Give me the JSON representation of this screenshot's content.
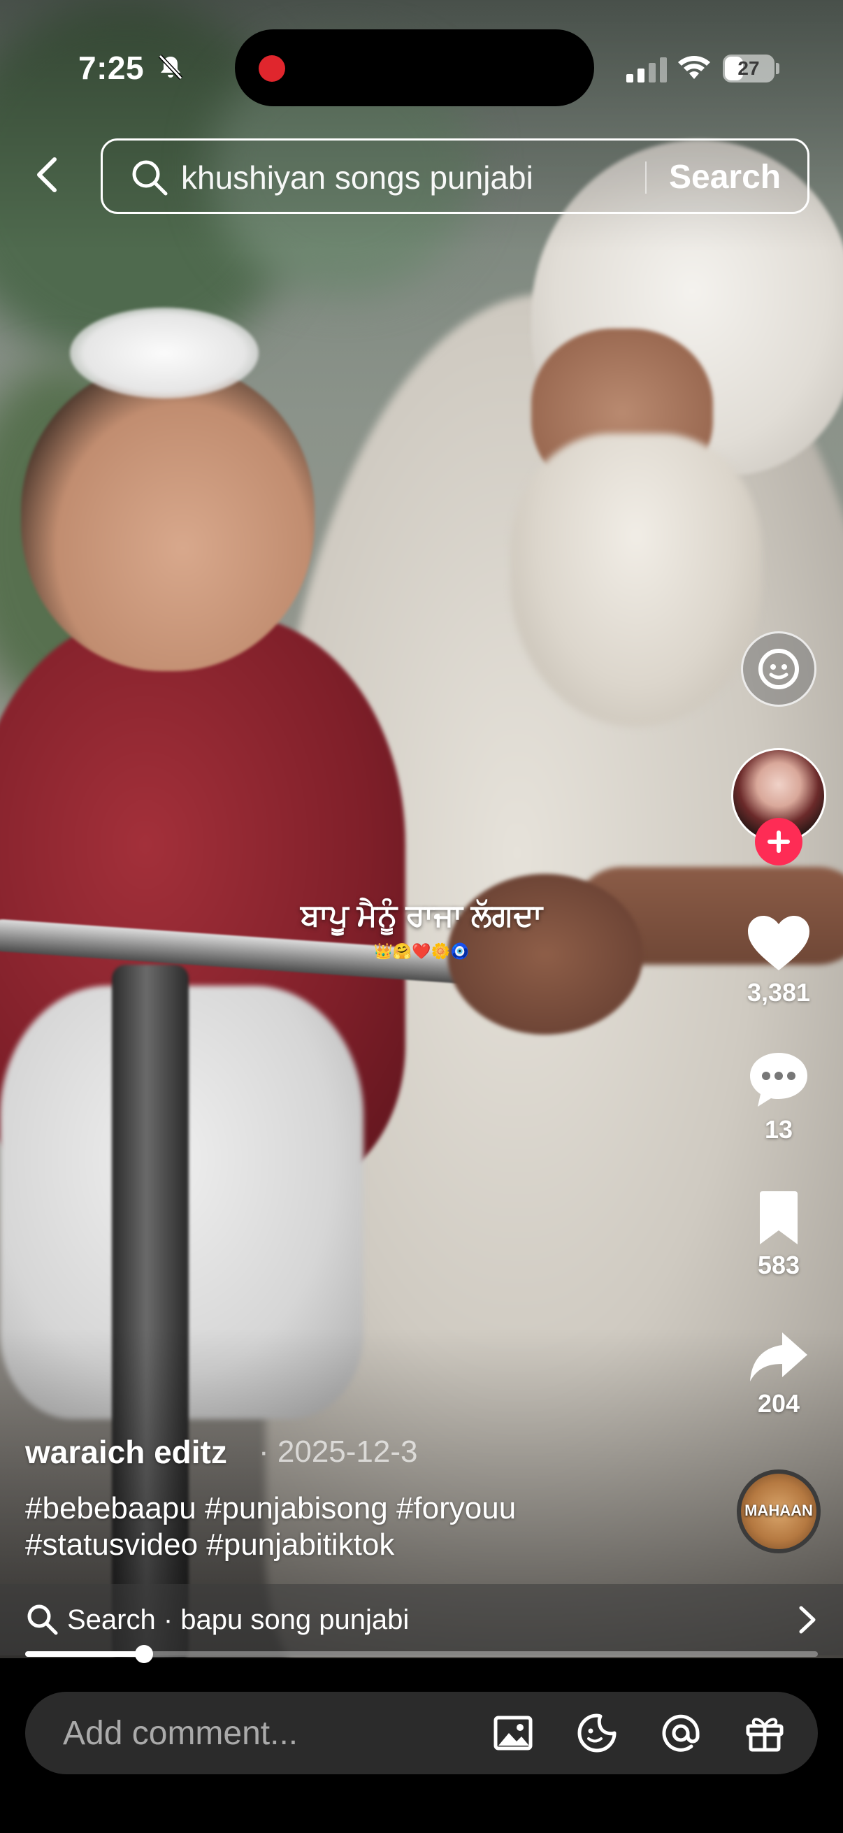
{
  "status_bar": {
    "time": "7:25",
    "battery": "27",
    "icons": [
      "bell-slash-icon",
      "signal-icon",
      "wifi-icon",
      "battery-icon"
    ]
  },
  "search": {
    "query": "khushiyan songs punjabi",
    "submit_label": "Search"
  },
  "video": {
    "caption": "ਬਾਪੂ ਮੈਨੂੰ ਰਾਜਾ ਲੱਗਦਾ",
    "caption_emoji": "👑🤗❤️🌼🧿",
    "progress": 0.15
  },
  "actions": {
    "likes": "3,381",
    "comments": "13",
    "saves": "583",
    "shares": "204"
  },
  "post": {
    "author": "waraich editz",
    "date": "· 2025-12-3",
    "description": "#bebebaapu #punjabisong #foryouu #statusvideo #punjabitiktok",
    "music_label": "MAHAAN"
  },
  "suggestion": {
    "text": "Search · bapu song punjabi"
  },
  "comment": {
    "placeholder": "Add comment..."
  },
  "colors": {
    "accent": "#fe2c55",
    "recording": "#e0262d",
    "comment_bar": "#2b2b2b"
  }
}
